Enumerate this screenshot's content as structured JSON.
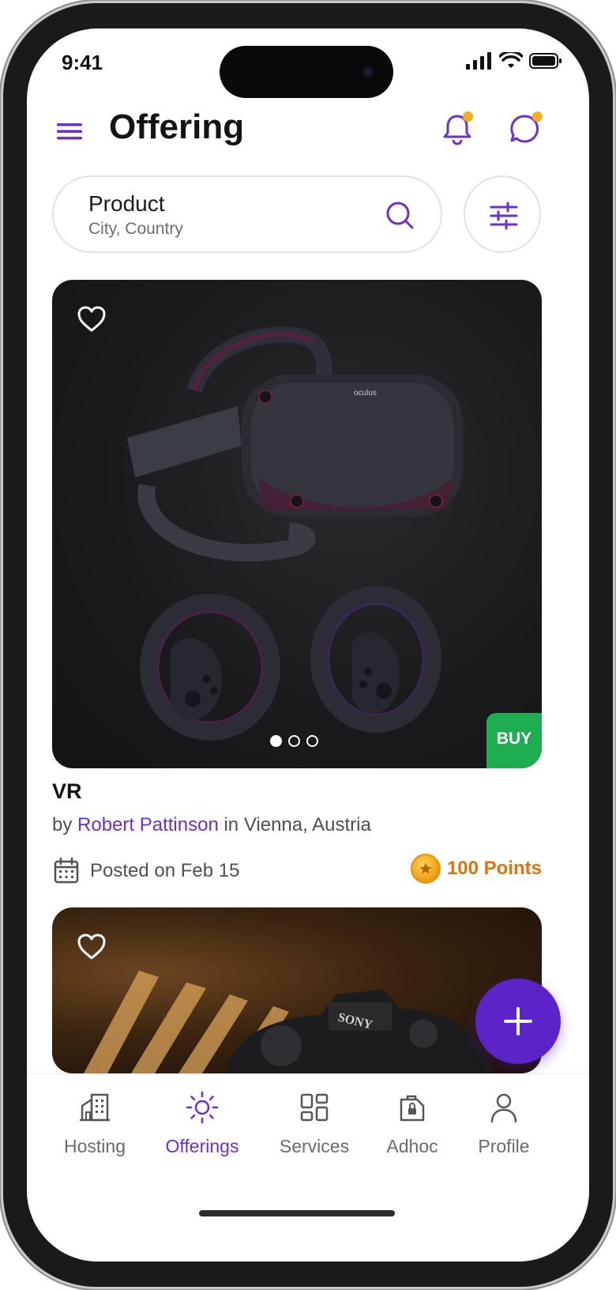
{
  "status_bar": {
    "time": "9:41"
  },
  "header": {
    "title": "Offering"
  },
  "search": {
    "label": "Product",
    "sublabel": "City, Country"
  },
  "listing": {
    "title": "VR",
    "by_prefix": "by ",
    "seller": "Robert Pattinson",
    "location_text": " in Vienna, Austria",
    "posted": "Posted on Feb 15",
    "points": "100 Points",
    "buy_label": "BUY",
    "image_brand": "oculus",
    "carousel": {
      "count": 3,
      "active": 1
    }
  },
  "listing2": {
    "image_brand": "SONY"
  },
  "tabs": [
    {
      "label": "Hosting",
      "icon": "building-icon",
      "active": false
    },
    {
      "label": "Offerings",
      "icon": "sun-icon",
      "active": true
    },
    {
      "label": "Services",
      "icon": "grid-icon",
      "active": false
    },
    {
      "label": "Adhoc",
      "icon": "lock-bag-icon",
      "active": false
    },
    {
      "label": "Profile",
      "icon": "person-icon",
      "active": false
    }
  ],
  "colors": {
    "accent": "#6b2fd6",
    "fab": "#5b23c8",
    "buy": "#1fad52",
    "points": "#e0730d",
    "badge": "#f1b11d"
  }
}
